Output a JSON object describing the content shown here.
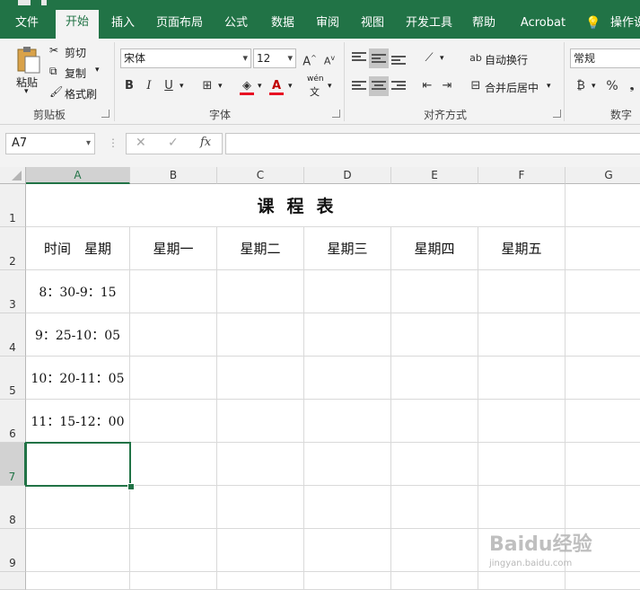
{
  "ribbon_tabs": [
    "文件",
    "开始",
    "插入",
    "页面布局",
    "公式",
    "数据",
    "审阅",
    "视图",
    "开发工具",
    "帮助",
    "Acrobat",
    "操作说明"
  ],
  "clipboard": {
    "paste": "粘贴",
    "cut": "剪切",
    "copy": "复制",
    "format_painter": "格式刷",
    "group_label": "剪贴板"
  },
  "font": {
    "name": "宋体",
    "size": "12",
    "bold": "B",
    "italic": "I",
    "underline": "U",
    "phonetic": "wén",
    "group_label": "字体"
  },
  "alignment": {
    "wrap_text": "自动换行",
    "merge_center": "合并后居中",
    "group_label": "对齐方式"
  },
  "number": {
    "format": "常规",
    "percent": "%",
    "group_label": "数字"
  },
  "formula_bar": {
    "name_box": "A7",
    "fx": "fx",
    "cancel": "✕",
    "enter": "✓",
    "value": ""
  },
  "columns": [
    "A",
    "B",
    "C",
    "D",
    "E",
    "F",
    "G"
  ],
  "rows": [
    "1",
    "2",
    "3",
    "4",
    "5",
    "6",
    "7",
    "8",
    "9"
  ],
  "sheet": {
    "title": "课程表",
    "header": [
      "时间　星期",
      "星期一",
      "星期二",
      "星期三",
      "星期四",
      "星期五"
    ],
    "times": [
      "8：30-9：15",
      "9：25-10：05",
      "10：20-11：05",
      "11：15-12：00"
    ]
  },
  "selected_cell": "A7",
  "colors": {
    "excel_green": "#217346",
    "ribbon_bg": "#f3f3f3",
    "gridline": "#d9d9d9",
    "font_red": "#e81123"
  },
  "watermark": {
    "logo": "Baidu经验",
    "url": "jingyan.baidu.com"
  }
}
